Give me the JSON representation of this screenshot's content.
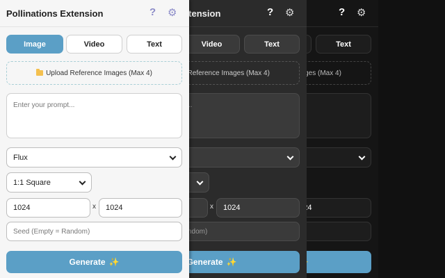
{
  "extension": {
    "title": "Pollinations Extension",
    "help_glyph": "?",
    "settings_glyph": "⚙",
    "tabs": [
      {
        "label": "Image",
        "active": true
      },
      {
        "label": "Video",
        "active": false
      },
      {
        "label": "Text",
        "active": false
      }
    ],
    "upload_label": "Upload Reference Images (Max 4)",
    "prompt_placeholder": "Enter your prompt...",
    "model_selected": "Flux",
    "aspect_selected": "1:1 Square",
    "width_value": "1024",
    "times_sign": "x",
    "height_value": "1024",
    "seed_placeholder": "Seed (Empty = Random)",
    "generate_label": "Generate",
    "generate_glyph": "✨"
  },
  "colors": {
    "accent": "#5b9fc6",
    "light_bg": "#f6f6f6",
    "dark_bg": "#2b2b2b",
    "darker_bg": "#151515"
  },
  "icons": [
    "help-icon",
    "gear-icon",
    "folder-icon",
    "sparkle-icon",
    "chevron-down-icon"
  ]
}
